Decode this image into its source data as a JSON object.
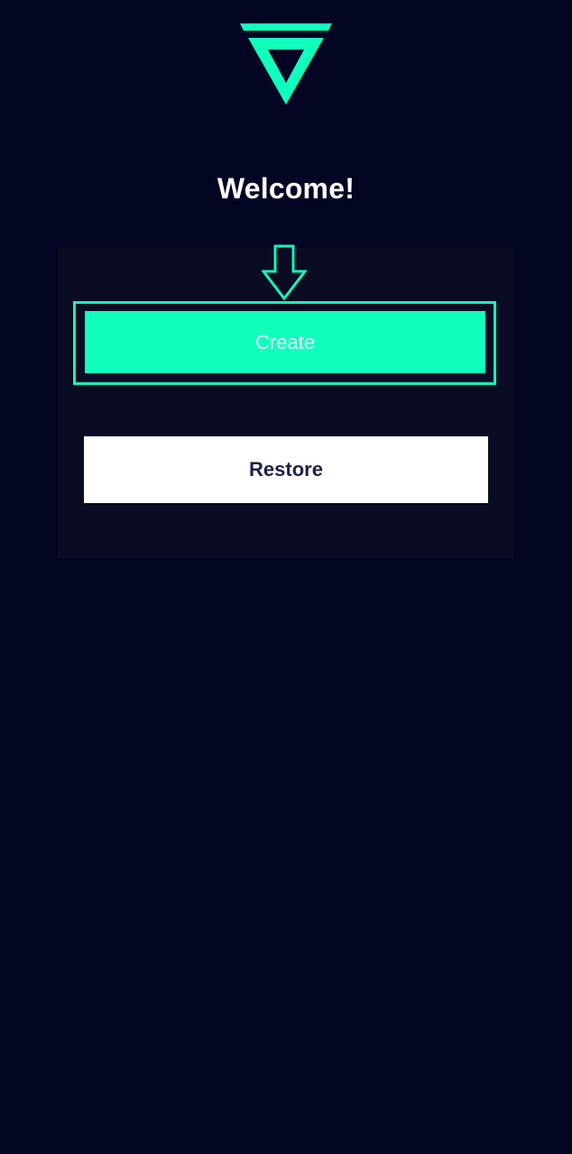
{
  "colors": {
    "background": "#030622",
    "card": "#0a0c24",
    "accent": "#11ffbd",
    "highlight": "#14f5bb",
    "restore_bg": "#ffffff",
    "restore_text": "#1e1f4e"
  },
  "logo": {
    "icon": "triangle-logo-icon"
  },
  "welcome": {
    "title": "Welcome!"
  },
  "hint": {
    "icon": "arrow-down-outline-icon"
  },
  "actions": {
    "create_label": "Create",
    "restore_label": "Restore"
  }
}
